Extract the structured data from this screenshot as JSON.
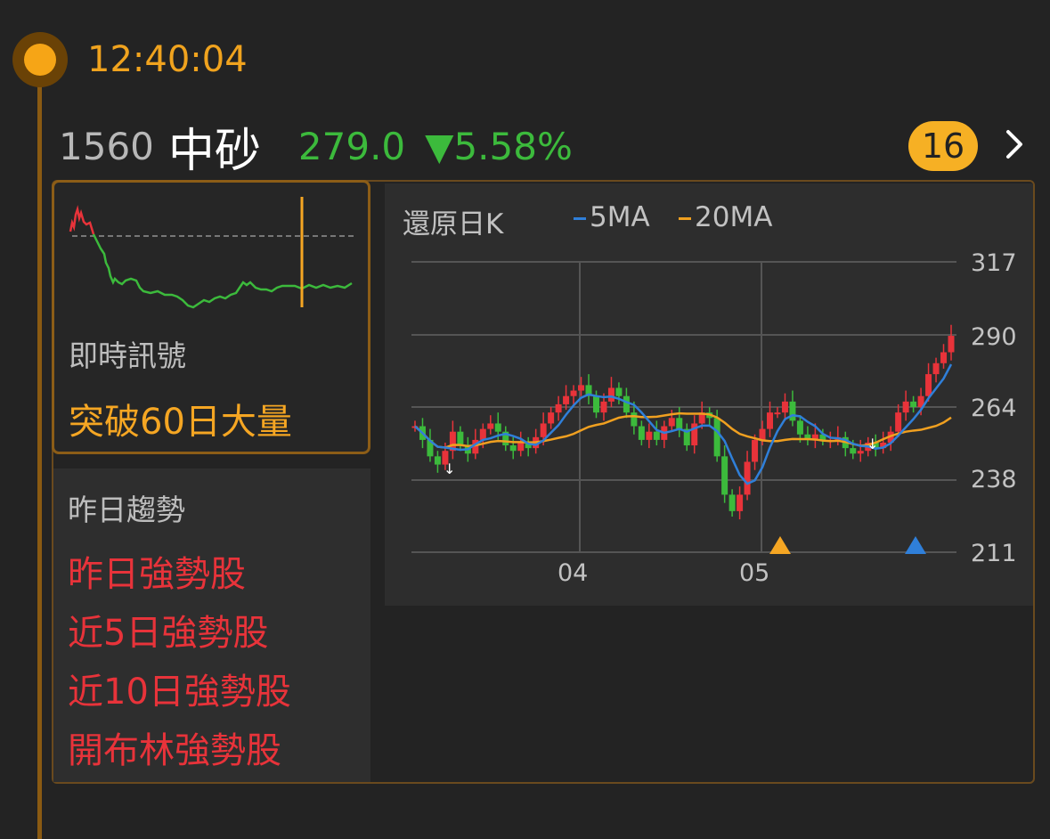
{
  "time": "12:40:04",
  "stock": {
    "code": "1560",
    "name": "中砂",
    "price": "279.0",
    "change": "▼5.58%",
    "badge_count": "16"
  },
  "signal": {
    "label": "即時訊號",
    "value": "突破60日大量"
  },
  "trend": {
    "label": "昨日趨勢",
    "items": [
      "昨日強勢股",
      "近5日強勢股",
      "近10日強勢股",
      "開布林強勢股"
    ]
  },
  "kline": {
    "title": "還原日K",
    "ma5_label": "5MA",
    "ma20_label": "20MA",
    "ma5_color": "#2f7fd9",
    "ma20_color": "#f0a020"
  },
  "colors": {
    "up": "#e8333a",
    "down": "#3cba3c",
    "accent": "#f5a623"
  },
  "chart_data": {
    "type": "candlestick",
    "title": "還原日K",
    "y_ticks": [
      317,
      290,
      264,
      238,
      211
    ],
    "x_ticks": [
      "04",
      "05"
    ],
    "ylim": [
      211,
      317
    ],
    "legend": [
      "5MA",
      "20MA"
    ]
  }
}
